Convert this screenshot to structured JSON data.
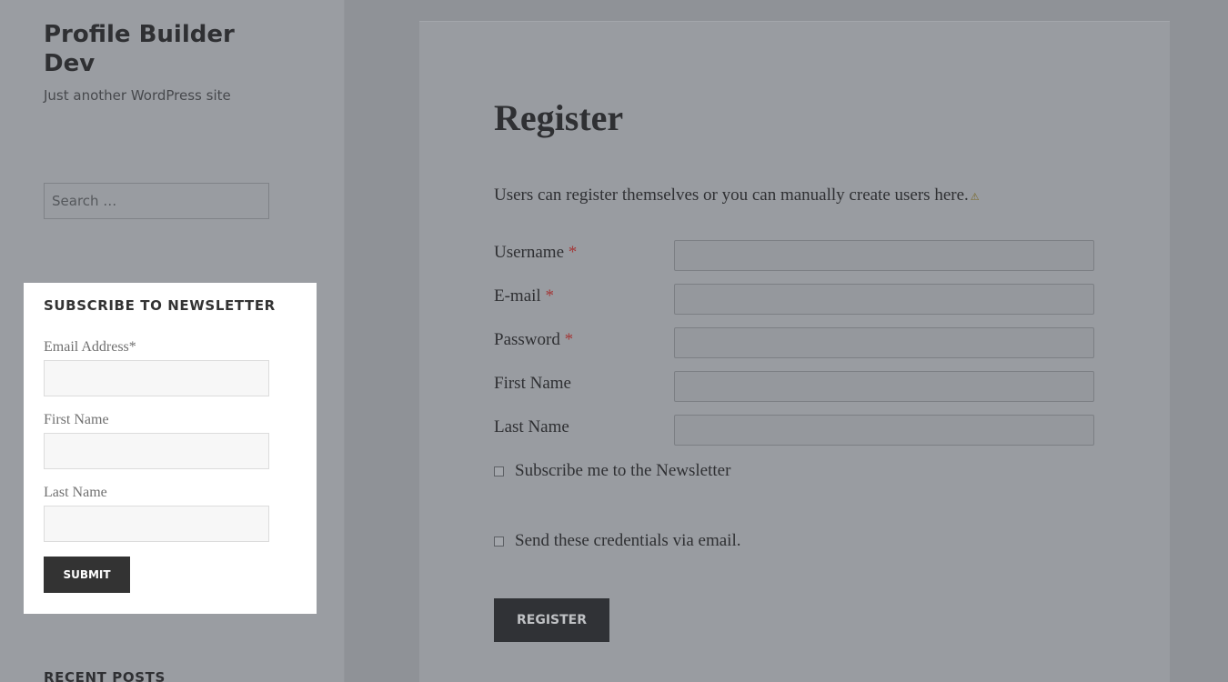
{
  "sidebar": {
    "site_title": "Profile Builder Dev",
    "site_description": "Just another WordPress site",
    "search_placeholder": "Search …",
    "recent_posts_title": "RECENT POSTS"
  },
  "newsletter": {
    "title": "SUBSCRIBE TO NEWSLETTER",
    "email_label": "Email Address*",
    "email_value": "",
    "first_name_label": "First Name",
    "first_name_value": "",
    "last_name_label": "Last Name",
    "last_name_value": "",
    "submit_label": "SUBMIT"
  },
  "main": {
    "title": "Register",
    "intro": "Users can register themselves or you can manually create users here.",
    "warning_icon": "⚠",
    "required_mark": "*",
    "fields": [
      {
        "label": "Username",
        "required": true,
        "value": ""
      },
      {
        "label": "E-mail",
        "required": true,
        "value": ""
      },
      {
        "label": "Password",
        "required": true,
        "value": ""
      },
      {
        "label": "First Name",
        "required": false,
        "value": ""
      },
      {
        "label": "Last Name",
        "required": false,
        "value": ""
      }
    ],
    "newsletter_checkbox_label": "Subscribe me to the Newsletter",
    "newsletter_checked": false,
    "credentials_checkbox_label": "Send these credentials via email.",
    "credentials_checked": false,
    "register_label": "REGISTER"
  },
  "colors": {
    "overlay": "#8f9297",
    "highlight": "#ffffff",
    "required": "#a33a3a",
    "button_dark": "#333333"
  }
}
